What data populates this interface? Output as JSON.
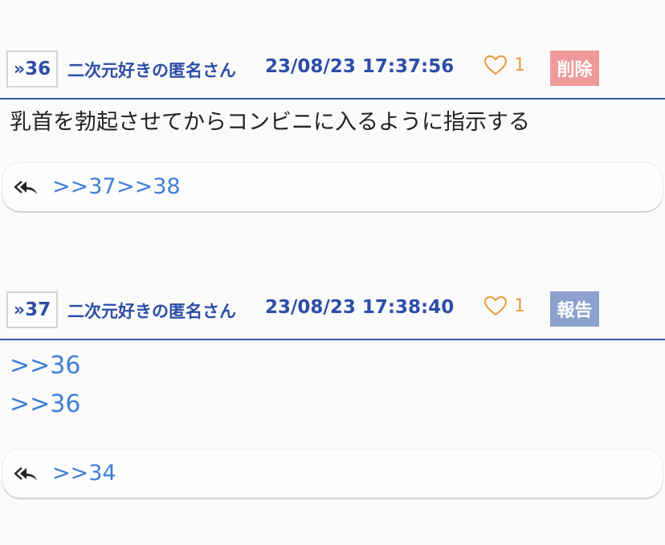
{
  "posts": [
    {
      "number": "36",
      "author": "二次元好きの匿名さん",
      "datetime": "23/08/23 17:37:56",
      "likes": "1",
      "action_label": "削除",
      "body_text": "乳首を勃起させてからコンビニに入るように指示する",
      "replies": [
        ">>37",
        ">>38"
      ]
    },
    {
      "number": "37",
      "author": "二次元好きの匿名さん",
      "datetime": "23/08/23 17:38:40",
      "likes": "1",
      "action_label": "報告",
      "body_links": [
        ">>36",
        ">>36"
      ],
      "replies": [
        ">>34"
      ]
    }
  ],
  "icons": {
    "post_number_prefix": "chevron-double-right-icon",
    "like": "heart-outline-icon",
    "reply": "reply-all-icon"
  },
  "colors": {
    "accent": "#2d4ea6",
    "link": "#3f7fd6",
    "like": "#e89a3c",
    "delete_button": "#ee9a9a",
    "report_button": "#8ca2cc"
  }
}
